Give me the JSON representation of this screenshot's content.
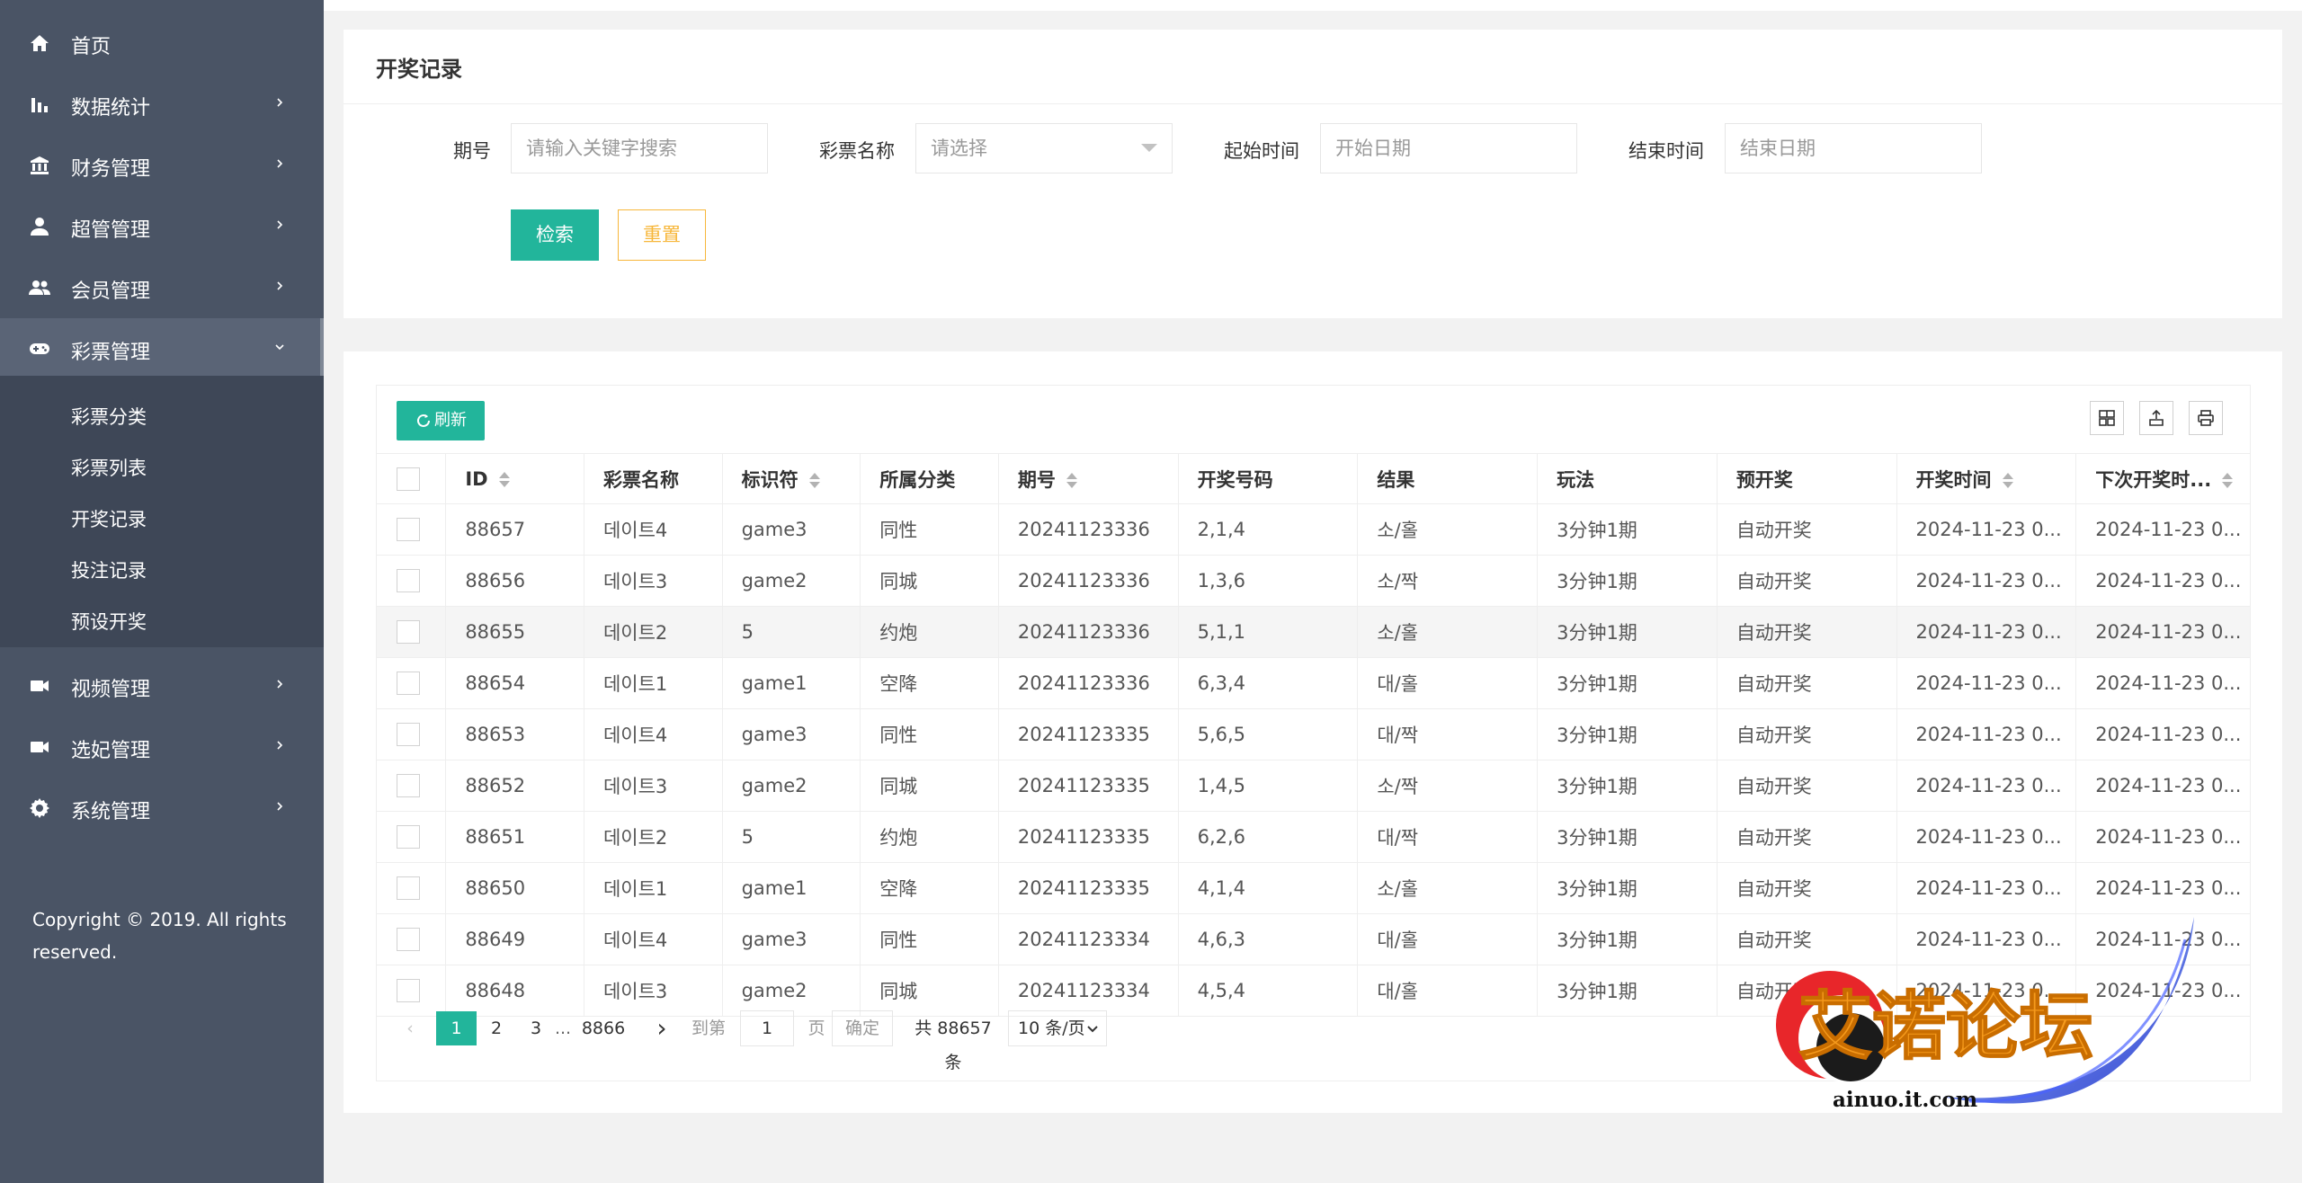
{
  "sidebar": {
    "items": [
      {
        "label": "首页",
        "icon": "home-icon",
        "arrow": false
      },
      {
        "label": "数据统计",
        "icon": "bar-chart-icon",
        "arrow": true
      },
      {
        "label": "财务管理",
        "icon": "bank-icon",
        "arrow": true
      },
      {
        "label": "超管管理",
        "icon": "user-icon",
        "arrow": true
      },
      {
        "label": "会员管理",
        "icon": "users-icon",
        "arrow": true
      },
      {
        "label": "彩票管理",
        "icon": "gamepad-icon",
        "arrow": true,
        "expanded": true
      },
      {
        "label": "视频管理",
        "icon": "video-icon",
        "arrow": true
      },
      {
        "label": "选妃管理",
        "icon": "video-icon",
        "arrow": true
      },
      {
        "label": "系统管理",
        "icon": "gear-icon",
        "arrow": true
      }
    ],
    "submenu": [
      "彩票分类",
      "彩票列表",
      "开奖记录",
      "投注记录",
      "预设开奖"
    ],
    "copyright_line1": "Copyright © 2019. All rights",
    "copyright_line2": "reserved."
  },
  "search": {
    "title": "开奖记录",
    "issue_label": "期号",
    "issue_placeholder": "请输入关键字搜索",
    "lottery_label": "彩票名称",
    "lottery_placeholder": "请选择",
    "start_label": "起始时间",
    "start_placeholder": "开始日期",
    "end_label": "结束时间",
    "end_placeholder": "结束日期",
    "search_button": "检索",
    "reset_button": "重置"
  },
  "table": {
    "refresh_label": "刷新",
    "tools": [
      "columns-icon",
      "export-icon",
      "print-icon"
    ],
    "columns": [
      "ID",
      "彩票名称",
      "标识符",
      "所属分类",
      "期号",
      "开奖号码",
      "结果",
      "玩法",
      "预开奖",
      "开奖时间",
      "下次开奖时..."
    ],
    "rows": [
      [
        "88657",
        "데이트4",
        "game3",
        "同性",
        "20241123336",
        "2,1,4",
        "소/홀",
        "3分钟1期",
        "自动开奖",
        "2024-11-23 0...",
        "2024-11-23 0..."
      ],
      [
        "88656",
        "데이트3",
        "game2",
        "同城",
        "20241123336",
        "1,3,6",
        "소/짝",
        "3分钟1期",
        "自动开奖",
        "2024-11-23 0...",
        "2024-11-23 0..."
      ],
      [
        "88655",
        "데이트2",
        "5",
        "约炮",
        "20241123336",
        "5,1,1",
        "소/홀",
        "3分钟1期",
        "自动开奖",
        "2024-11-23 0...",
        "2024-11-23 0..."
      ],
      [
        "88654",
        "데이트1",
        "game1",
        "空降",
        "20241123336",
        "6,3,4",
        "대/홀",
        "3分钟1期",
        "自动开奖",
        "2024-11-23 0...",
        "2024-11-23 0..."
      ],
      [
        "88653",
        "데이트4",
        "game3",
        "同性",
        "20241123335",
        "5,6,5",
        "대/짝",
        "3分钟1期",
        "自动开奖",
        "2024-11-23 0...",
        "2024-11-23 0..."
      ],
      [
        "88652",
        "데이트3",
        "game2",
        "同城",
        "20241123335",
        "1,4,5",
        "소/짝",
        "3分钟1期",
        "自动开奖",
        "2024-11-23 0...",
        "2024-11-23 0..."
      ],
      [
        "88651",
        "데이트2",
        "5",
        "约炮",
        "20241123335",
        "6,2,6",
        "대/짝",
        "3分钟1期",
        "自动开奖",
        "2024-11-23 0...",
        "2024-11-23 0..."
      ],
      [
        "88650",
        "데이트1",
        "game1",
        "空降",
        "20241123335",
        "4,1,4",
        "소/홀",
        "3分钟1期",
        "自动开奖",
        "2024-11-23 0...",
        "2024-11-23 0..."
      ],
      [
        "88649",
        "데이트4",
        "game3",
        "同性",
        "20241123334",
        "4,6,3",
        "대/홀",
        "3分钟1期",
        "自动开奖",
        "2024-11-23 0...",
        "2024-11-23 0..."
      ],
      [
        "88648",
        "데이트3",
        "game2",
        "同城",
        "20241123334",
        "4,5,4",
        "대/홀",
        "3分钟1期",
        "自动开奖",
        "2024-11-23 0...",
        "2024-11-23 0..."
      ]
    ]
  },
  "pager": {
    "pages": [
      "1",
      "2",
      "3",
      "...",
      "8866"
    ],
    "goto_label": "到第",
    "goto_value": "1",
    "page_unit": "页",
    "confirm_label": "确定",
    "total_text": "共 88657 条",
    "page_size": "10 条/页"
  },
  "watermark": {
    "title": "艾诺论坛",
    "url": "ainuo.it.com"
  },
  "colors": {
    "sidebar_bg": "#4a5465",
    "accent": "#22b59b",
    "reset": "#f7b73b"
  }
}
